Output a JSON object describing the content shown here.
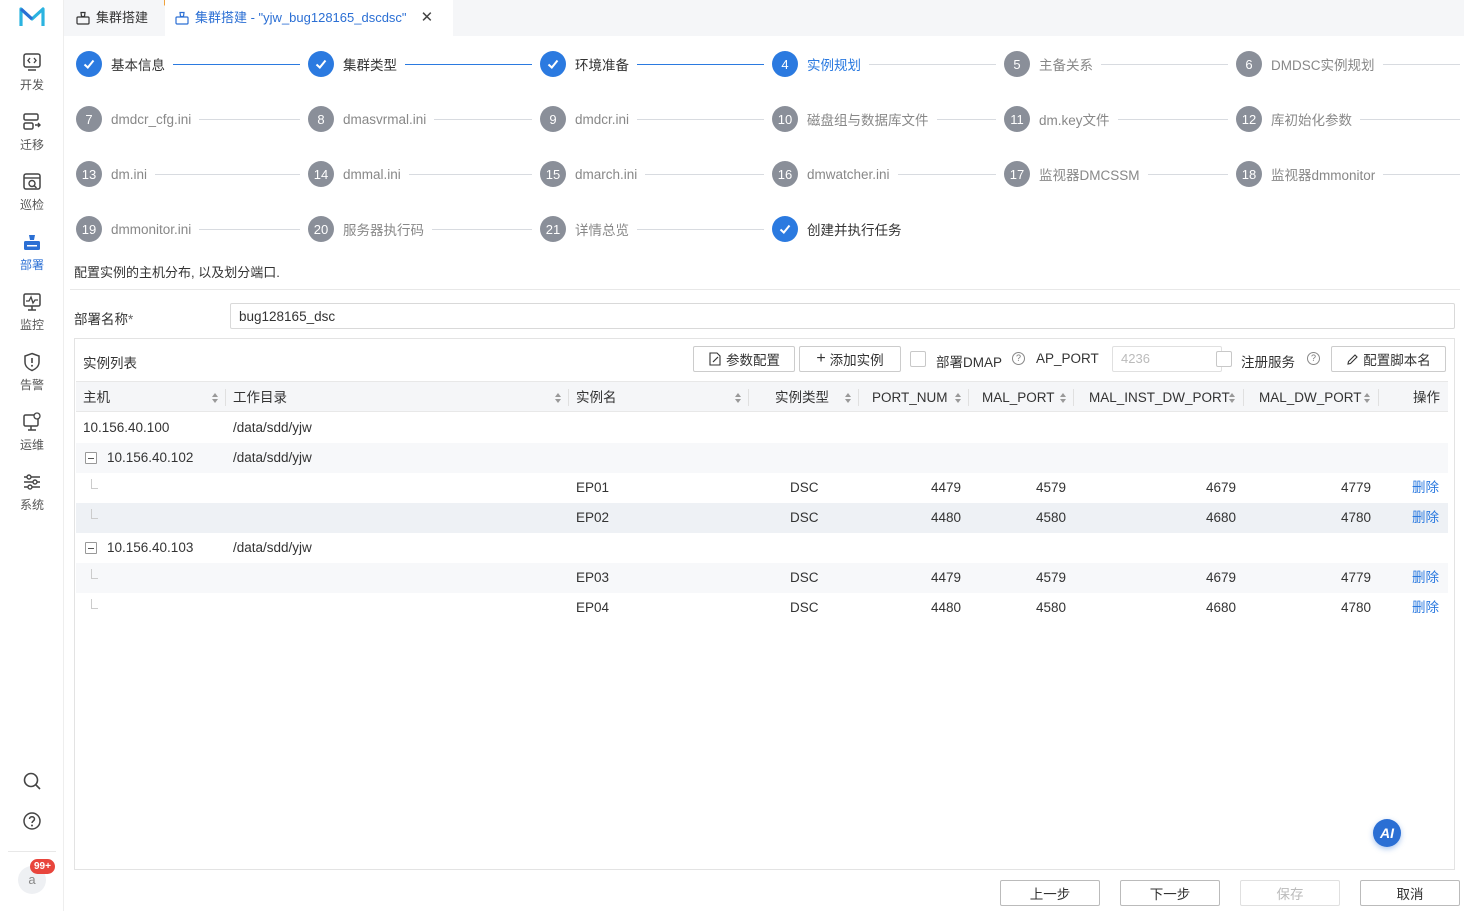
{
  "sidebar": {
    "items": [
      {
        "label": "开发",
        "icon": "code-icon"
      },
      {
        "label": "迁移",
        "icon": "migrate-icon"
      },
      {
        "label": "巡检",
        "icon": "inspect-icon"
      },
      {
        "label": "部署",
        "icon": "deploy-icon",
        "active": true
      },
      {
        "label": "监控",
        "icon": "monitor-icon"
      },
      {
        "label": "告警",
        "icon": "alert-icon"
      },
      {
        "label": "运维",
        "icon": "ops-icon"
      },
      {
        "label": "系统",
        "icon": "settings-icon"
      }
    ],
    "avatar": "a",
    "badge": "99+"
  },
  "tabs": [
    {
      "label": "集群搭建"
    },
    {
      "label": "集群搭建 - \"yjw_bug128165_dscdsc\"",
      "active": true
    }
  ],
  "steps": [
    {
      "num": "1",
      "label": "基本信息",
      "state": "done"
    },
    {
      "num": "2",
      "label": "集群类型",
      "state": "done"
    },
    {
      "num": "3",
      "label": "环境准备",
      "state": "done"
    },
    {
      "num": "4",
      "label": "实例规划",
      "state": "current"
    },
    {
      "num": "5",
      "label": "主备关系",
      "state": "todo"
    },
    {
      "num": "6",
      "label": "DMDSC实例规划",
      "state": "todo"
    },
    {
      "num": "7",
      "label": "dmdcr_cfg.ini",
      "state": "todo"
    },
    {
      "num": "8",
      "label": "dmasvrmal.ini",
      "state": "todo"
    },
    {
      "num": "9",
      "label": "dmdcr.ini",
      "state": "todo"
    },
    {
      "num": "10",
      "label": "磁盘组与数据库文件",
      "state": "todo"
    },
    {
      "num": "11",
      "label": "dm.key文件",
      "state": "todo"
    },
    {
      "num": "12",
      "label": "库初始化参数",
      "state": "todo"
    },
    {
      "num": "13",
      "label": "dm.ini",
      "state": "todo"
    },
    {
      "num": "14",
      "label": "dmmal.ini",
      "state": "todo"
    },
    {
      "num": "15",
      "label": "dmarch.ini",
      "state": "todo"
    },
    {
      "num": "16",
      "label": "dmwatcher.ini",
      "state": "todo"
    },
    {
      "num": "17",
      "label": "监视器DMCSSM",
      "state": "todo"
    },
    {
      "num": "18",
      "label": "监视器dmmonitor",
      "state": "todo"
    },
    {
      "num": "19",
      "label": "dmmonitor.ini",
      "state": "todo"
    },
    {
      "num": "20",
      "label": "服务器执行码",
      "state": "todo"
    },
    {
      "num": "21",
      "label": "详情总览",
      "state": "todo"
    },
    {
      "num": "22",
      "label": "创建并执行任务",
      "state": "done"
    }
  ],
  "description": "配置实例的主机分布, 以及划分端口.",
  "deploy_name": {
    "label": "部署名称",
    "required_mark": "*",
    "value": "bug128165_dsc"
  },
  "panel": {
    "title": "实例列表",
    "param_config_label": "参数配置",
    "add_instance_label": "添加实例",
    "deploy_dmap_label": "部署DMAP",
    "ap_port_label": "AP_PORT",
    "ap_port_placeholder": "4236",
    "register_service_label": "注册服务",
    "config_script_label": "配置脚本名"
  },
  "table": {
    "columns": [
      "主机",
      "工作目录",
      "实例名",
      "实例类型",
      "PORT_NUM",
      "MAL_PORT",
      "MAL_INST_DW_PORT",
      "MAL_DW_PORT",
      "操作"
    ],
    "hosts": [
      {
        "host": "10.156.40.100",
        "dir": "/data/sdd/yjw"
      },
      {
        "host": "10.156.40.102",
        "dir": "/data/sdd/yjw"
      },
      {
        "host": "10.156.40.103",
        "dir": "/data/sdd/yjw"
      }
    ],
    "instances": [
      {
        "name": "EP01",
        "type": "DSC",
        "port_num": "4479",
        "mal_port": "4579",
        "mal_inst_dw_port": "4679",
        "mal_dw_port": "4779",
        "action": "删除"
      },
      {
        "name": "EP02",
        "type": "DSC",
        "port_num": "4480",
        "mal_port": "4580",
        "mal_inst_dw_port": "4680",
        "mal_dw_port": "4780",
        "action": "删除"
      },
      {
        "name": "EP03",
        "type": "DSC",
        "port_num": "4479",
        "mal_port": "4579",
        "mal_inst_dw_port": "4679",
        "mal_dw_port": "4779",
        "action": "删除"
      },
      {
        "name": "EP04",
        "type": "DSC",
        "port_num": "4480",
        "mal_port": "4580",
        "mal_inst_dw_port": "4680",
        "mal_dw_port": "4780",
        "action": "删除"
      }
    ]
  },
  "ai_label": "AI",
  "footer": {
    "prev": "上一步",
    "next": "下一步",
    "save": "保存",
    "cancel": "取消"
  },
  "colors": {
    "accent": "#2b7ae0",
    "brand": "#2b6fd4"
  }
}
